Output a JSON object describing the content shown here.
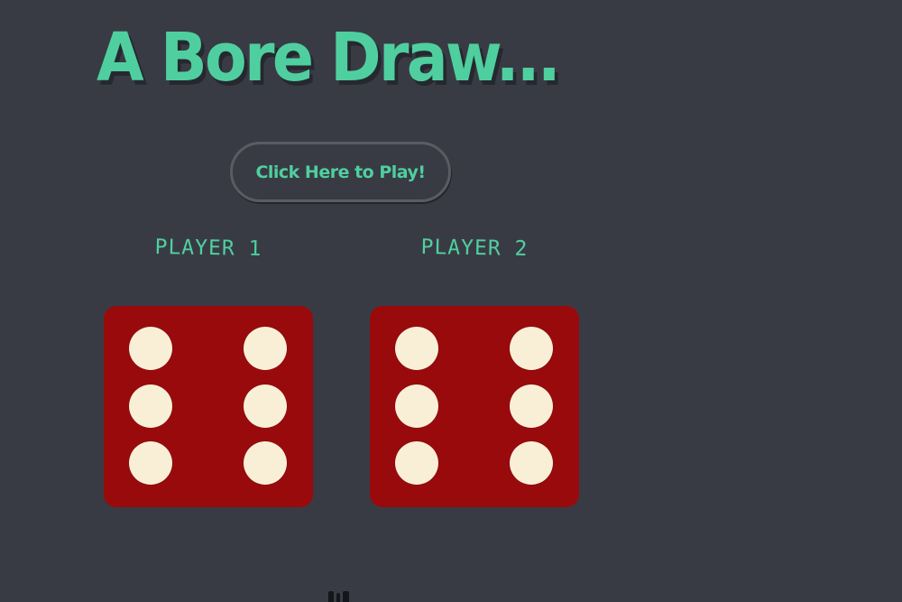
{
  "header": {
    "title": "A Bore Draw..."
  },
  "controls": {
    "play_label": "Click Here to Play!"
  },
  "players": [
    {
      "label": "PLAYER 1",
      "die_face": 6
    },
    {
      "label": "PLAYER 2",
      "die_face": 6
    }
  ],
  "colors": {
    "background": "#393b44",
    "accent": "#4fcf9f",
    "die_body": "#990a0d",
    "pip": "#f9efd6"
  }
}
